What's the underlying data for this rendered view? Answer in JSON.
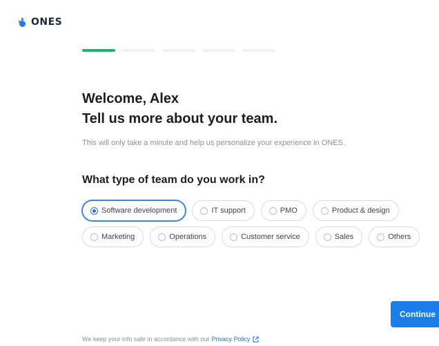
{
  "brand": {
    "name": "ONES",
    "logo_icon": "ones-logo-icon",
    "accent_color": "#1a7dea",
    "progress_color": "#22b26d"
  },
  "progress": {
    "total_steps": 5,
    "current_step": 1
  },
  "header": {
    "welcome": "Welcome, Alex",
    "headline": "Tell us more about your team.",
    "subtitle": "This will only take a minute and help us personalize your experience in ONES."
  },
  "question": {
    "label": "What type of team do you work in?"
  },
  "options": {
    "row1": [
      {
        "label": "Software development",
        "selected": true
      },
      {
        "label": "IT support",
        "selected": false
      },
      {
        "label": "PMO",
        "selected": false
      },
      {
        "label": "Product & design",
        "selected": false
      }
    ],
    "row2": [
      {
        "label": "Marketing",
        "selected": false
      },
      {
        "label": "Operations",
        "selected": false
      },
      {
        "label": "Customer service",
        "selected": false
      },
      {
        "label": "Sales",
        "selected": false
      },
      {
        "label": "Others",
        "selected": false
      }
    ]
  },
  "actions": {
    "continue_label": "Continue"
  },
  "footer": {
    "text": "We keep your info safe in accordance with our",
    "link_label": "Privacy Policy",
    "link_icon": "external-link-icon"
  }
}
